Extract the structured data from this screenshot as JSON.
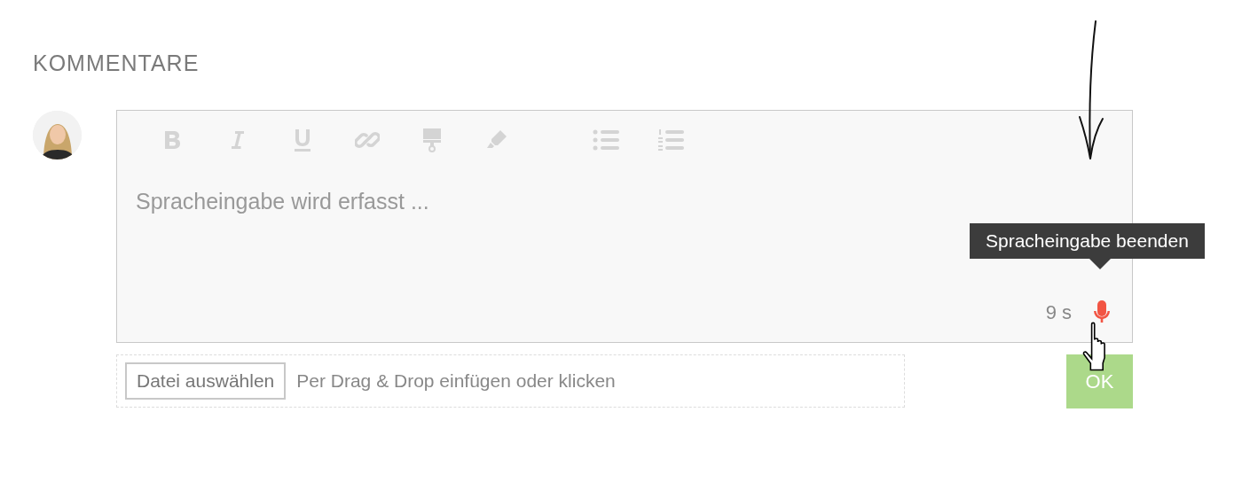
{
  "section_title": "KOMMENTARE",
  "editor": {
    "toolbar": [
      {
        "kind": "bold"
      },
      {
        "kind": "italic"
      },
      {
        "kind": "underline"
      },
      {
        "kind": "link"
      },
      {
        "kind": "paint"
      },
      {
        "kind": "highlight"
      },
      {
        "kind": "bullets"
      },
      {
        "kind": "numbers"
      }
    ],
    "placeholder": "Spracheingabe wird erfasst ...",
    "timer": "9 s",
    "recording": true,
    "tooltip": "Spracheingabe beenden"
  },
  "upload": {
    "button": "Datei auswählen",
    "hint": "Per Drag & Drop einfügen oder klicken"
  },
  "submit": "OK"
}
